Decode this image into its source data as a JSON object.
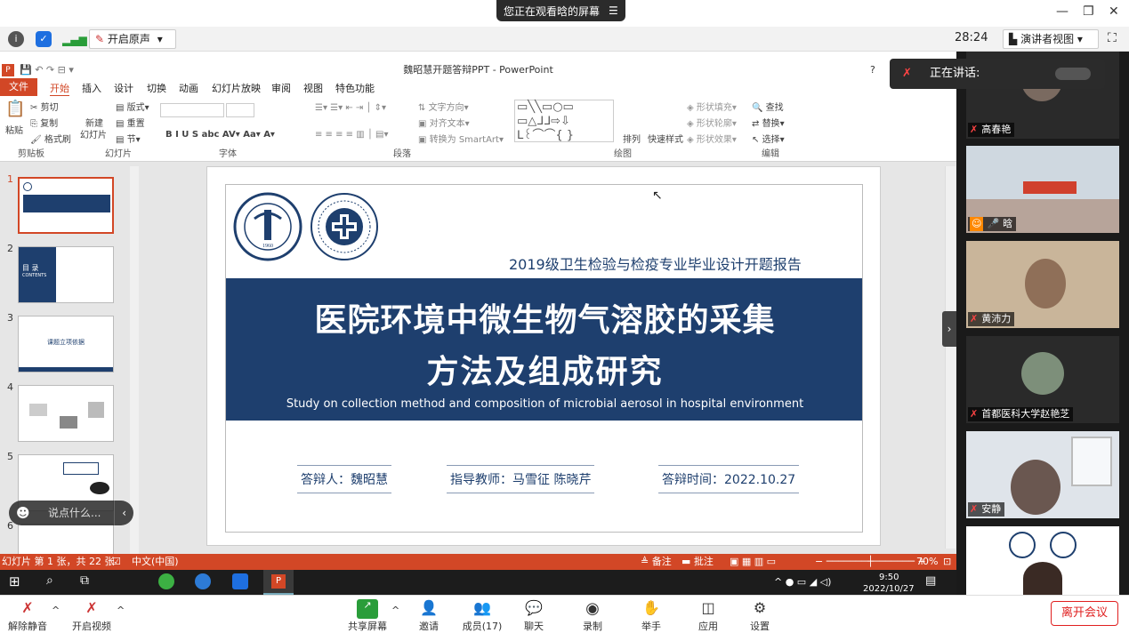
{
  "top": {
    "share_text": "您正在观看晗的屏幕",
    "time": "28:24",
    "speaker_view": "演讲者视图",
    "original_sound": "开启原声"
  },
  "ppt": {
    "title": "魏昭慧开题答辩PPT - PowerPoint",
    "file_tab": "文件",
    "tabs": [
      "开始",
      "插入",
      "设计",
      "切换",
      "动画",
      "幻灯片放映",
      "审阅",
      "视图",
      "特色功能"
    ],
    "clipboard": {
      "paste": "粘贴",
      "cut": "剪切",
      "copy": "复制",
      "format": "格式刷",
      "label": "剪贴板"
    },
    "slides_grp": {
      "new": "新建",
      "new2": "幻灯片",
      "layout": "版式",
      "reset": "重置",
      "section": "节",
      "label": "幻灯片"
    },
    "font_label": "字体",
    "para_label": "段落",
    "draw_label": "绘图",
    "edit_label": "编辑",
    "para": {
      "dir": "文字方向",
      "align": "对齐文本",
      "smartart": "转换为 SmartArt"
    },
    "draw": {
      "arrange": "排列",
      "quick": "快速样式",
      "fill": "形状填充",
      "outline": "形状轮廓",
      "effect": "形状效果"
    },
    "edit": {
      "find": "查找",
      "replace": "替换",
      "select": "选择"
    },
    "slide_nums": [
      "1",
      "2",
      "3",
      "4",
      "5",
      "6"
    ],
    "thumb2_title": "目 录",
    "thumb2_sub": "CONTENTS",
    "thumb3_title": "课题立项依据",
    "slide": {
      "report": "2019级卫生检验与检疫专业毕业设计开题报告",
      "title1": "医院环境中微生物气溶胶的采集",
      "title2": "方法及组成研究",
      "subtitle": "Study on collection method and composition of microbial aerosol in hospital environment",
      "defender": "答辩人：魏昭慧",
      "advisor": "指导教师：马雪征  陈晓芹",
      "date": "答辩时间：2022.10.27",
      "logo1_text": "CAPITAL MEDICAL UNIVERSITY",
      "logo1_year": "1960"
    },
    "status_left": "幻灯片 第 1 张，共 22 张",
    "lang": "中文(中国)",
    "notes": "备注",
    "comments": "批注",
    "zoom": "70%"
  },
  "taskbar": {
    "time": "9:50",
    "date": "2022/10/27"
  },
  "chat": {
    "placeholder": "说点什么..."
  },
  "speaking": "正在讲话:",
  "participants": [
    {
      "name": "高春艳"
    },
    {
      "name": "晗"
    },
    {
      "name": "黄沛力"
    },
    {
      "name": "首都医科大学赵艳芝"
    },
    {
      "name": "安静"
    },
    {
      "name": ""
    }
  ],
  "bottom": {
    "mute": "解除静音",
    "video": "开启视频",
    "share": "共享屏幕",
    "invite": "邀请",
    "members": "成员(17)",
    "chat": "聊天",
    "record": "录制",
    "raise": "举手",
    "apps": "应用",
    "settings": "设置",
    "leave": "离开会议"
  },
  "colors": {
    "ppt_accent": "#d24726",
    "slide_band": "#1e3f6e",
    "leave": "#e02020"
  }
}
